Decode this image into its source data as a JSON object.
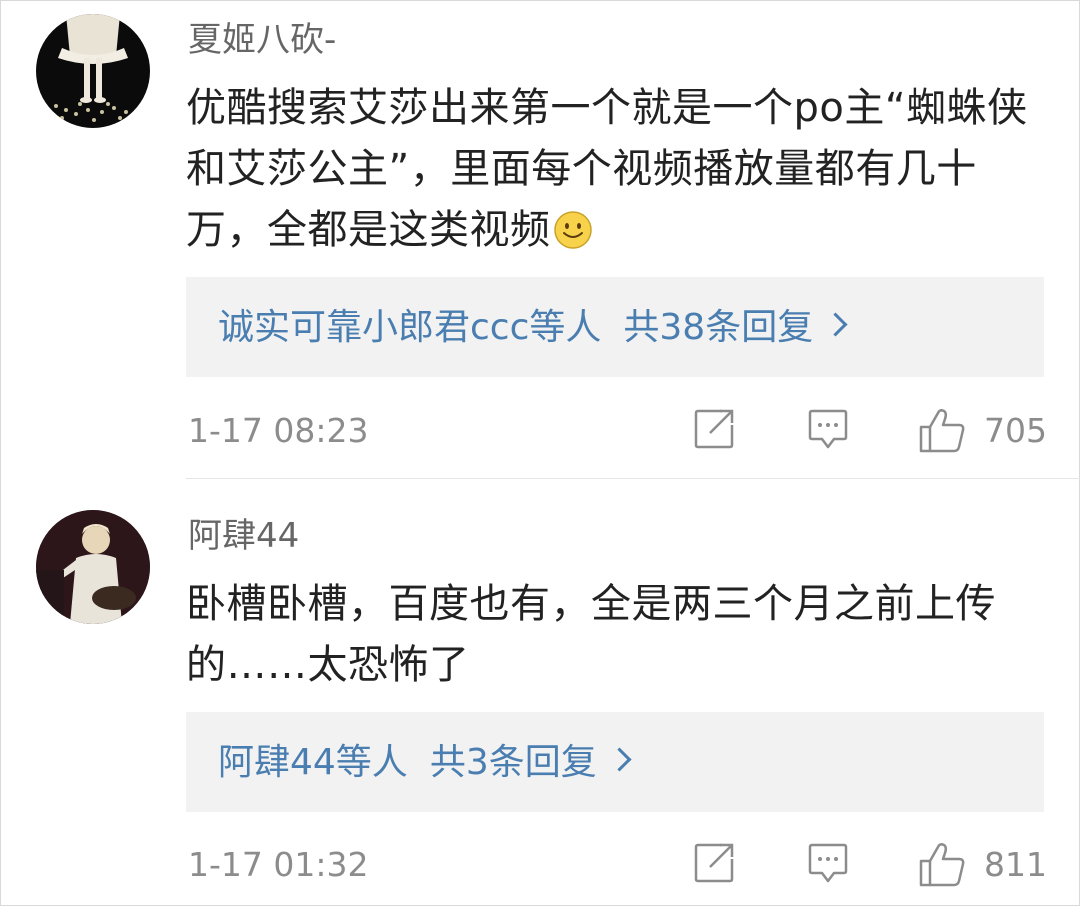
{
  "comments": [
    {
      "username": "夏姬八砍-",
      "text": "优酷搜索艾莎出来第一个就是一个po主“蜘蛛侠和艾莎公主”，里面每个视频播放量都有几十万，全都是这类视频",
      "emoji": "smile-emoji",
      "replies": {
        "users": "诚实可靠小郎君ccc等人",
        "count_text": "共38条回复"
      },
      "time": "1-17 08:23",
      "likes": "705",
      "icons": {
        "share": "share-edit-icon",
        "comment": "comment-icon",
        "like": "thumbs-up-icon"
      }
    },
    {
      "username": "阿肆44",
      "text": "卧槽卧槽，百度也有，全是两三个月之前上传的……太恐怖了",
      "replies": {
        "users": "阿肆44等人",
        "count_text": "共3条回复"
      },
      "time": "1-17 01:32",
      "likes": "811",
      "icons": {
        "share": "share-edit-icon",
        "comment": "comment-icon",
        "like": "thumbs-up-icon"
      }
    }
  ],
  "colors": {
    "link": "#4a7eb1",
    "meta": "#8c8c8c",
    "reply_bg": "#f2f2f2",
    "username": "#666666"
  }
}
